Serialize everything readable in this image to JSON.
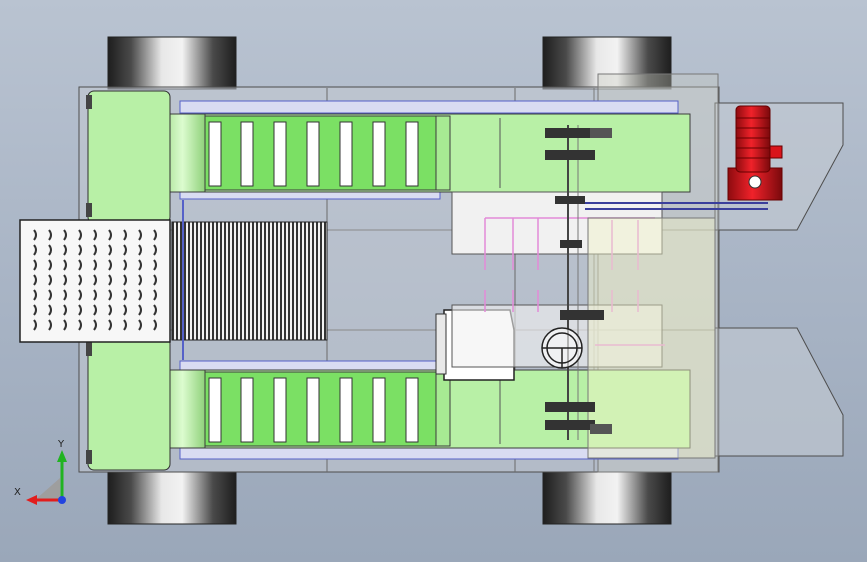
{
  "viewport": {
    "background_top": "#b9c3d1",
    "background_bottom": "#9aa7b9"
  },
  "colors": {
    "tire_dark": "#2b2b2b",
    "tire_light": "#e4e4e4",
    "conveyor_green": "#b8f0a6",
    "slat_green": "#7be064",
    "roller_green": "#c9f7b9",
    "rail_blue": "#5561c8",
    "motor_red": "#d9141b",
    "frame_grey": "#c7ccd4",
    "wire_pink": "#e28ad8",
    "triad_x": "#e21d1d",
    "triad_y": "#21b321",
    "triad_z": "#2244e0"
  },
  "triad": {
    "x_label": "X",
    "y_label": "Y"
  }
}
